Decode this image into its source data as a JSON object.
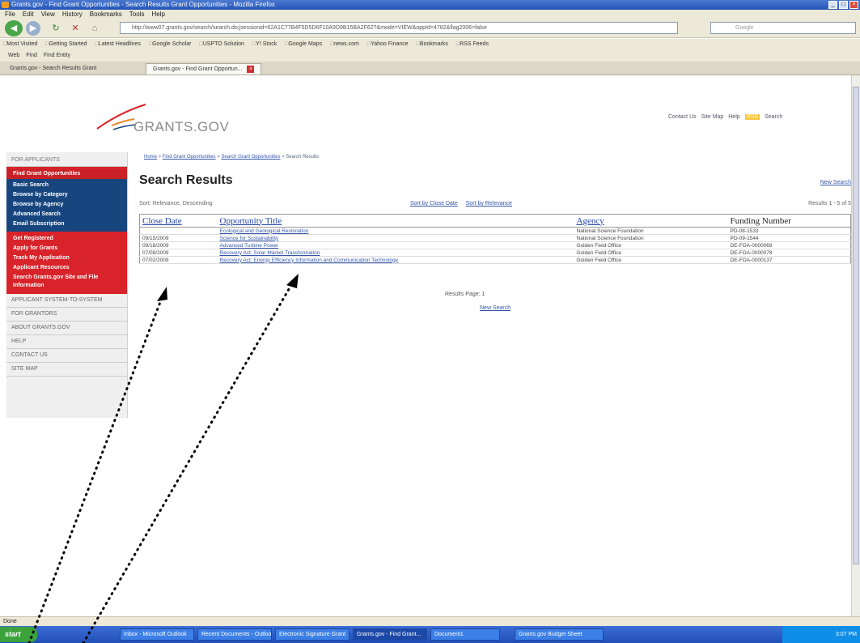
{
  "browser": {
    "title": "Grants.gov - Find Grant Opportunities - Search Results Grant Opportunities - Mozilla Firefox",
    "menu": [
      "File",
      "Edit",
      "View",
      "History",
      "Bookmarks",
      "Tools",
      "Help"
    ],
    "url": "http://www07.grants.gov/search/search.do;jsessionid=62A1C77B4F5D5D6F10A9D9B15BA2F62?&mode=VIEW&oppId=4782&flag2006=false",
    "search_placeholder": "Google",
    "bookmarks": [
      "Most Visited",
      "Getting Started",
      "Latest Headlines",
      "Google Scholar",
      "USPTO Solution",
      "Y! Stock",
      "Google Maps",
      "news.com",
      "Yahoo Finance",
      "Bookmarks",
      "RSS Feeds"
    ],
    "toolbar2": [
      "Web",
      "Find",
      "Find Entity"
    ],
    "tabs": [
      {
        "label": "Grants.gov - Search Results Grant"
      },
      {
        "label": "Grants.gov - Find Grant Opportun..."
      }
    ],
    "status": "Done"
  },
  "site": {
    "logo": "GRANTS.GOV",
    "toplinks": [
      "Contact Us",
      "Site Map",
      "Help",
      "RSS",
      "Search"
    ]
  },
  "sidebar": {
    "head": "FOR APPLICANTS",
    "find_items": [
      "Find Grant Opportunities",
      "Basic Search",
      "Browse by Category",
      "Browse by Agency",
      "Advanced Search",
      "Email Subscription"
    ],
    "apply_items": [
      "Get Registered",
      "Apply for Grants",
      "Track My Application",
      "Applicant Resources",
      "Search Grants.gov Site and File Information"
    ],
    "gray_items": [
      "Applicant System-to-System",
      "For Grantors",
      "About Grants.gov",
      "Help",
      "Contact Us",
      "Site Map"
    ]
  },
  "main": {
    "breadcrumb": [
      "Home",
      "Find Grant Opportunities",
      "Search Grant Opportunities",
      "Search Results"
    ],
    "title": "Search Results",
    "new_search_top": "New Search",
    "sort_label": "Sort: Relevance, Descending",
    "sort_links": [
      "Sort by Close Date",
      "Sort by Relevance"
    ],
    "results_count": "Results 1 - 5 of 5",
    "headers": [
      "Close Date",
      "Opportunity Title",
      "Agency",
      "Funding Number"
    ],
    "rows": [
      {
        "date": "",
        "title": "Ecological and Geological Restoration",
        "agency": "National Science Foundation",
        "number": "PD-08-1533"
      },
      {
        "date": "09/15/2009",
        "title": "Science for Sustainability",
        "agency": "National Science Foundation",
        "number": "PD-09-1544"
      },
      {
        "date": "09/18/2009",
        "title": "Advanced Turbine Power",
        "agency": "Golden Field Office",
        "number": "DE-FOA-0000069"
      },
      {
        "date": "07/09/2009",
        "title": "Recovery Act: Solar Market Transformation",
        "agency": "Golden Field Office",
        "number": "DE-FOA-0000078"
      },
      {
        "date": "07/02/2009",
        "title": "Recovery Act: Energy Efficiency Information and Communication Technology",
        "agency": "Golden Field Office",
        "number": "DE-FOA-0000137"
      }
    ],
    "results_page": "Results Page:  1",
    "new_search_bottom": "New Search"
  },
  "taskbar": {
    "start": "start",
    "tasks": [
      "Inbox - Microsoft Outlook",
      "Recent Documents - Outlook",
      "Electronic Signature Grant",
      "Grants.gov - Find Grant...",
      "Document1",
      "Grants.gov Budget Sheet"
    ],
    "clock": "3:07 PM"
  },
  "colors": {
    "red": "#d8232a",
    "navy": "#17457e",
    "link": "#3355aa"
  }
}
